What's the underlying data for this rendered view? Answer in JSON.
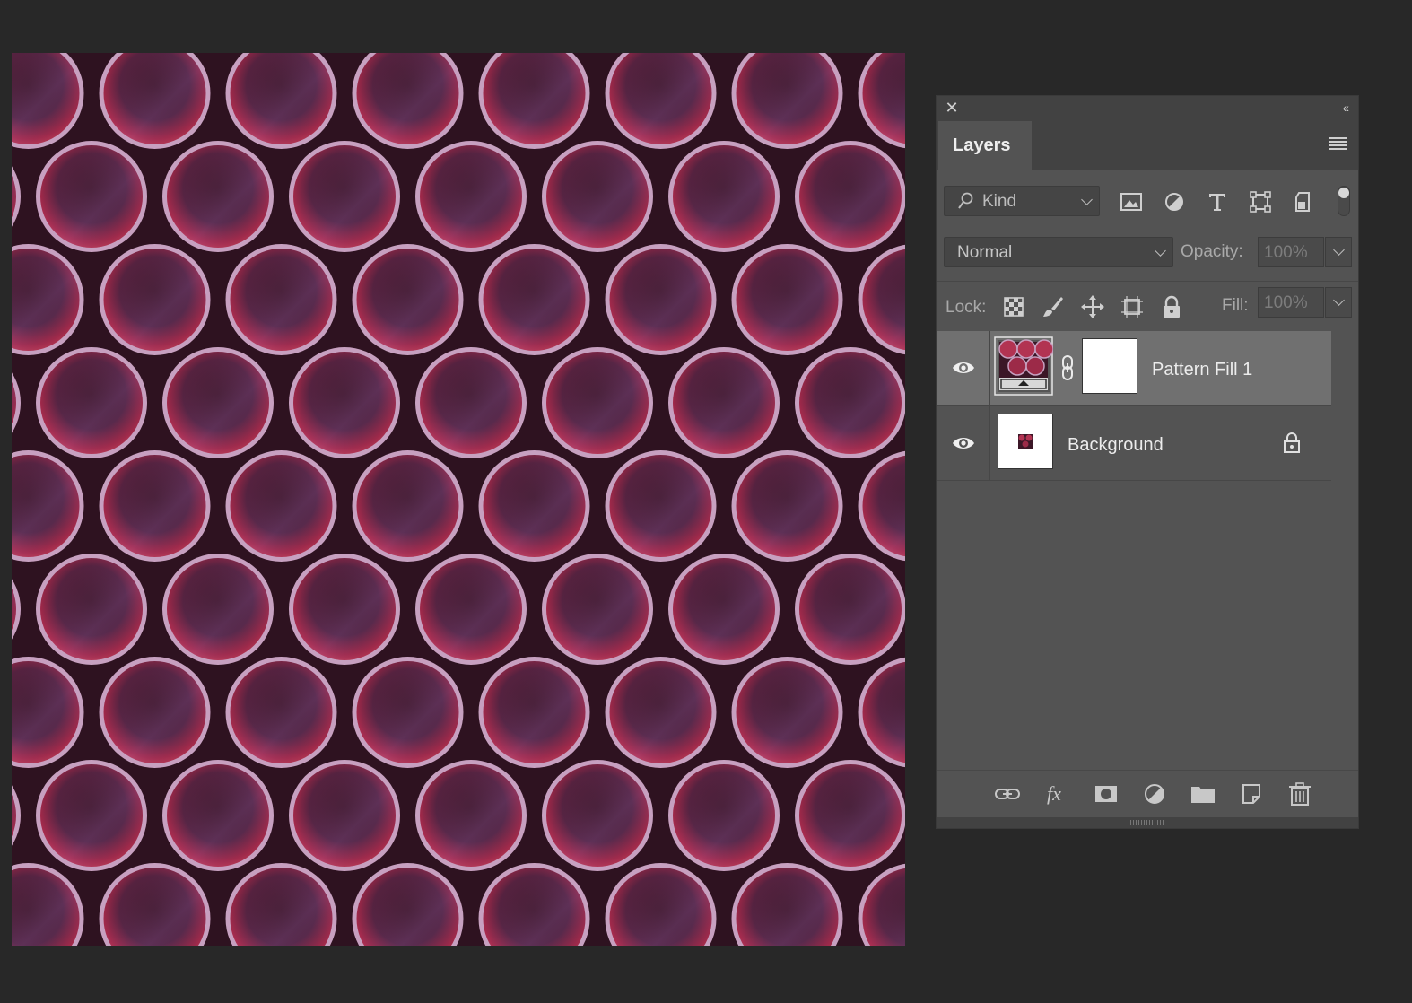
{
  "panel": {
    "title": "Layers",
    "close_icon": "close-icon",
    "collapse_icon": "collapse-panel-icon",
    "menu_icon": "panel-menu-icon"
  },
  "filter": {
    "kind_label": "Kind",
    "icons": [
      "image-filter-icon",
      "adjustment-filter-icon",
      "type-filter-icon",
      "shape-filter-icon",
      "smart-object-filter-icon"
    ]
  },
  "blend": {
    "mode": "Normal",
    "opacity_label": "Opacity:",
    "opacity_value": "100%"
  },
  "lock": {
    "label": "Lock:",
    "icons": [
      "lock-transparent-pixels-icon",
      "lock-image-pixels-icon",
      "lock-position-icon",
      "lock-artboard-icon",
      "lock-all-icon"
    ],
    "fill_label": "Fill:",
    "fill_value": "100%"
  },
  "layers": [
    {
      "name": "Pattern Fill 1",
      "visible": true,
      "selected": true,
      "type": "pattern-fill",
      "has_mask": true,
      "locked": false
    },
    {
      "name": "Background",
      "visible": true,
      "selected": false,
      "type": "image",
      "has_mask": false,
      "locked": true
    }
  ],
  "footer_icons": [
    "link-layers-icon",
    "fx-icon",
    "add-mask-icon",
    "new-adjustment-icon",
    "new-group-icon",
    "new-layer-icon",
    "delete-layer-icon"
  ],
  "colors": {
    "app_background": "#282828",
    "panel_background": "#535353",
    "selected_row": "#707070",
    "pattern_rim": "#c9a3c1",
    "pattern_red": "#d23a58",
    "pattern_dark": "#3b1727"
  }
}
